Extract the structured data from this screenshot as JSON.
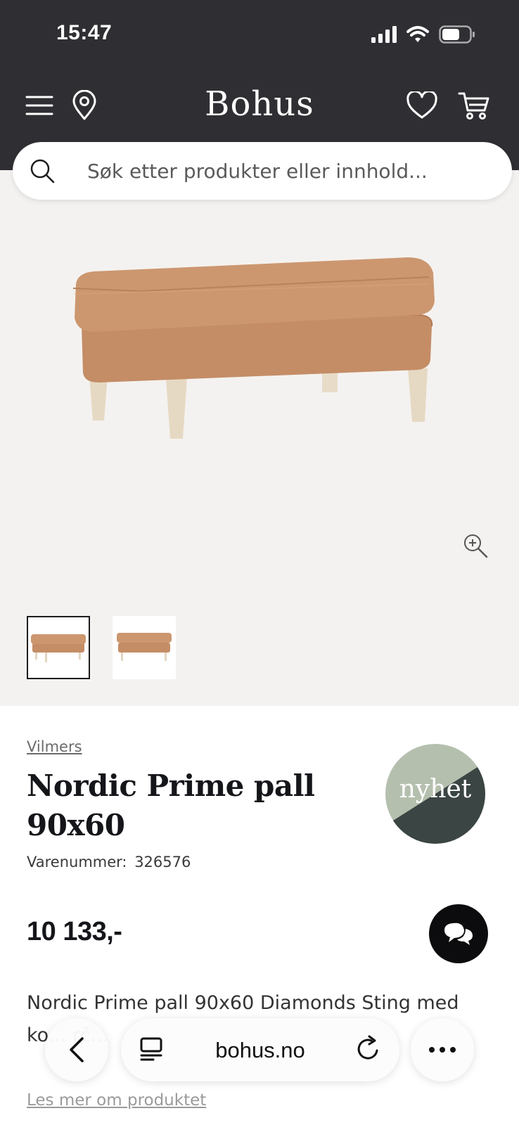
{
  "status_bar": {
    "time": "15:47"
  },
  "header": {
    "brand": "Bohus",
    "icons": [
      "menu-icon",
      "location-pin-icon",
      "heart-icon",
      "cart-icon"
    ],
    "background": "#2f2f33"
  },
  "search": {
    "placeholder": "Søk etter produkter eller innhold..."
  },
  "gallery": {
    "background": "#f4f2f0",
    "thumbnail_count": 2,
    "active_thumbnail": 1
  },
  "product": {
    "brand_link": "Vilmers",
    "title": "Nordic Prime pall 90x60",
    "sku_label": "Varenummer:",
    "sku": "326576",
    "badge": "nyhet",
    "price": "10 133,-",
    "description": "Nordic Prime pall 90x60 Diamonds Sting med ko... rč...",
    "read_more": "Les mer om produktet",
    "colors": {
      "badge_light": "#b5bfae",
      "badge_dark": "#3b4543",
      "upholstery": "#c9936c"
    }
  },
  "browser": {
    "url": "bohus.no"
  }
}
